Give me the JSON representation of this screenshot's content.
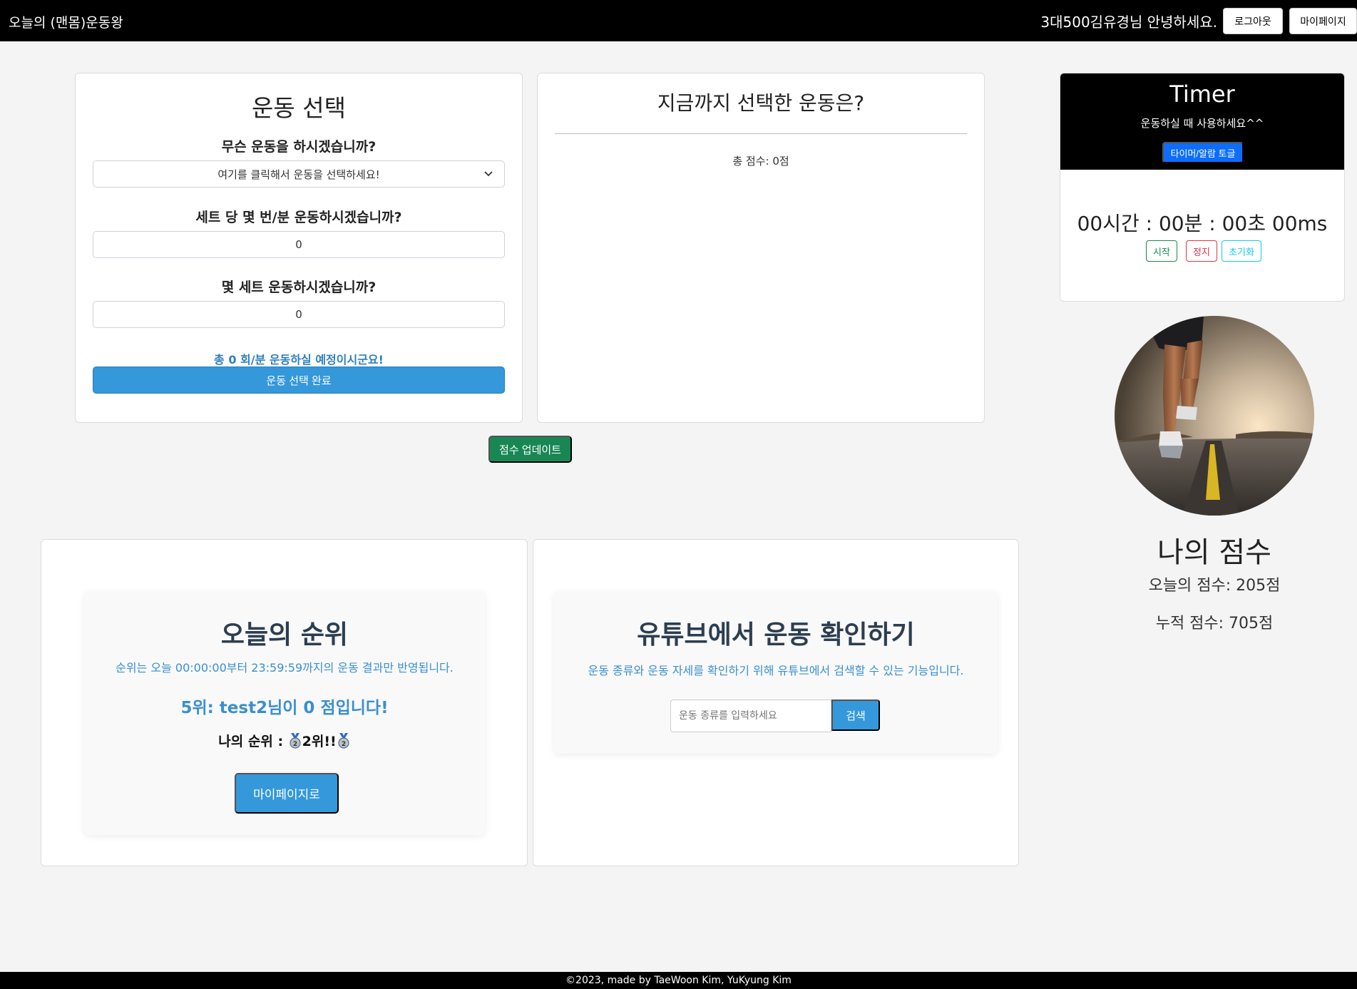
{
  "navbar": {
    "brand": "오늘의 (맨몸)운동왕",
    "greeting": "3대500김유경님 안녕하세요.",
    "logout_label": "로그아웃",
    "mypage_label": "마이페이지"
  },
  "select_card": {
    "title": "운동 선택",
    "q_exercise": "무슨 운동을 하시겠습니까?",
    "exercise_selected": "여기를 클릭해서 운동을 선택하세요!",
    "q_reps": "세트 당 몇 번/분 운동하시겠습니까?",
    "reps_value": "0",
    "q_sets": "몇 세트 운동하시겠습니까?",
    "sets_value": "0",
    "summary": "총 0 회/분 운동하실 예정이시군요!",
    "complete_label": "운동 선택 완료"
  },
  "selected_card": {
    "title": "지금까지 선택한 운동은?",
    "total_score": "총 점수: 0점"
  },
  "update_label": "점수 업데이트",
  "timer": {
    "title": "Timer",
    "subtitle": "운동하실 때 사용하세요^^",
    "toggle_label": "타이머/알람 토글",
    "display": "00시간 : 00분 : 00초 00ms",
    "start_label": "시작",
    "stop_label": "정지",
    "reset_label": "초기화"
  },
  "my_score": {
    "title": "나의 점수",
    "today": "오늘의 점수: 205점",
    "total": "누적 점수: 705점"
  },
  "ranking": {
    "title": "오늘의 순위",
    "note": "순위는 오늘 00:00:00부터 23:59:59까지의 운동 결과만 반영됩니다.",
    "rank_line": "5위: test2님이 0 점입니다!",
    "my_rank_prefix": "나의 순위 :",
    "my_rank_value": "2위!!",
    "mypage_button": "마이페이지로"
  },
  "youtube": {
    "title": "유튜브에서 운동 확인하기",
    "note": "운동 종류와 운동 자세를 확인하기 위해 유튜브에서 검색할 수 있는 기능입니다.",
    "search_placeholder": "운동 종류를 입력하세요",
    "search_label": "검색"
  },
  "footer": "©2023, made by TaeWoon Kim, YuKyung Kim",
  "colors": {
    "primary_blue": "#3498db",
    "update_green": "#198754",
    "timer_bg": "#000000"
  }
}
